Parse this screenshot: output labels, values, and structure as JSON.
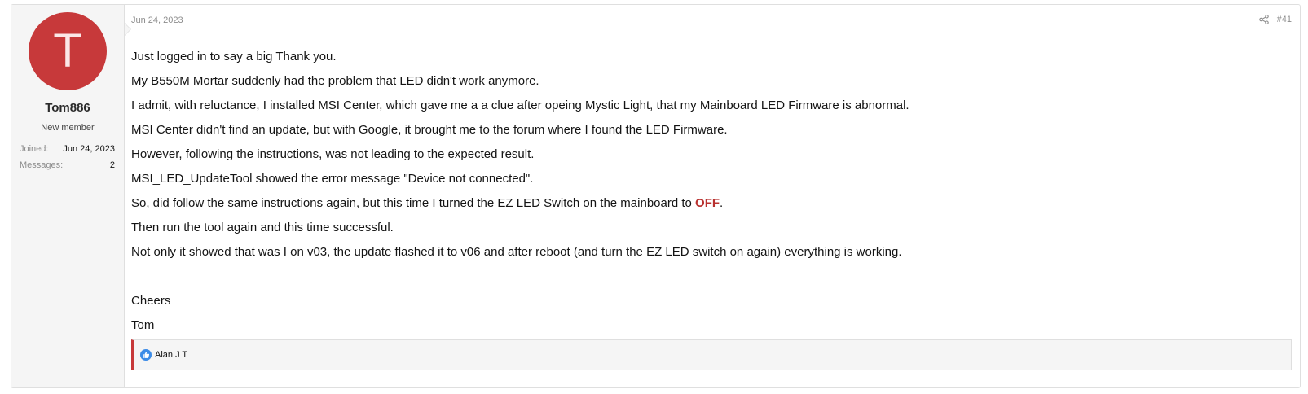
{
  "user": {
    "avatar_letter": "T",
    "avatar_color": "#c7393a",
    "name": "Tom886",
    "title": "New member",
    "joined_label": "Joined:",
    "joined_value": "Jun 24, 2023",
    "messages_label": "Messages:",
    "messages_value": "2"
  },
  "post": {
    "date": "Jun 24, 2023",
    "number": "#41",
    "share_icon": "share-icon",
    "lines": [
      "Just logged in to say a big Thank you.",
      "My B550M Mortar suddenly had the problem that LED didn't work anymore.",
      "I admit, with reluctance, I installed MSI Center, which gave me a a clue after opeing Mystic Light, that my Mainboard LED Firmware is abnormal.",
      "MSI Center didn't find an update, but with Google, it brought me to the forum where I found the LED Firmware.",
      "However, following the instructions, was not leading to the expected result.",
      "MSI_LED_UpdateTool showed the error message \"Device not connected\".",
      "So, did follow the same instructions again, but this time I turned the EZ LED Switch on the mainboard to ",
      "Then run the tool again and this time successful.",
      "Not only it showed that was I on v03, the update flashed it to v06 and after reboot (and turn the EZ LED switch on again) everything is working.",
      "Cheers",
      "Tom"
    ],
    "off_word": "OFF",
    "off_suffix": ".",
    "off_color": "#b8312f"
  },
  "reactions": {
    "icon": "like-icon",
    "users": "Alan J T"
  }
}
